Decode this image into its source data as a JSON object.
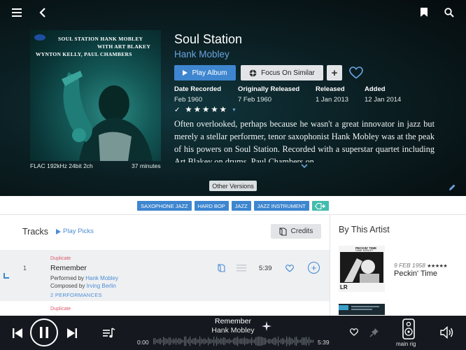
{
  "album": {
    "title": "Soul Station",
    "artist": "Hank Mobley",
    "cover_text": {
      "line1": "SOUL STATION",
      "line1b": "HANK MOBLEY",
      "line2": "WITH ART BLAKEY",
      "line3": "WYNTON KELLY, PAUL CHAMBERS"
    },
    "format": "FLAC 192kHz 24bit 2ch",
    "duration": "37 minutes",
    "play_label": "Play Album",
    "focus_label": "Focus On Similar",
    "add_label": "+",
    "meta": [
      {
        "label": "Date Recorded",
        "value": "Feb 1960"
      },
      {
        "label": "Originally Released",
        "value": "7 Feb 1960"
      },
      {
        "label": "Released",
        "value": "1 Jan 2013"
      },
      {
        "label": "Added",
        "value": "12 Jan 2014"
      }
    ],
    "rating": 5,
    "review": "Often overlooked, perhaps because he wasn't a great innovator in jazz but merely a stellar performer, tenor saxophonist Hank Mobley was at the peak of his powers on Soul Station. Recorded with a superstar quartet including Art Blakey on drums, Paul Chambers on",
    "other_versions_label": "Other Versions"
  },
  "tags": [
    "SAXOPHONE JAZZ",
    "HARD BOP",
    "JAZZ",
    "JAZZ INSTRUMENT"
  ],
  "tracks": {
    "heading": "Tracks",
    "play_picks_label": "Play Picks",
    "credits_label": "Credits",
    "items": [
      {
        "number": "1",
        "badge": "Duplicate",
        "title": "Remember",
        "performed_prefix": "Performed by ",
        "performer": "Hank Mobley",
        "composed_prefix": "Composed by ",
        "composer": "Irving Berlin",
        "performances": "2 PERFORMANCES",
        "time": "5:39"
      }
    ],
    "next_badge": "Duplicate"
  },
  "by_artist": {
    "heading": "By This Artist",
    "items": [
      {
        "date": "9 FEB 1958",
        "stars": "★★★★★",
        "title": "Peckin' Time",
        "cover_top": "PECKIN' TIME",
        "cover_sub": "HANK MOBLEY",
        "cover_badge": "LR"
      }
    ]
  },
  "player": {
    "title": "Remember",
    "artist": "Hank Mobley",
    "position": "0:00",
    "duration": "5:39",
    "zone": "main rig"
  },
  "colors": {
    "accent": "#3e86cf",
    "tag_add": "#43bcae",
    "duplicate": "#d95a6a",
    "player_bg": "#15191f"
  }
}
